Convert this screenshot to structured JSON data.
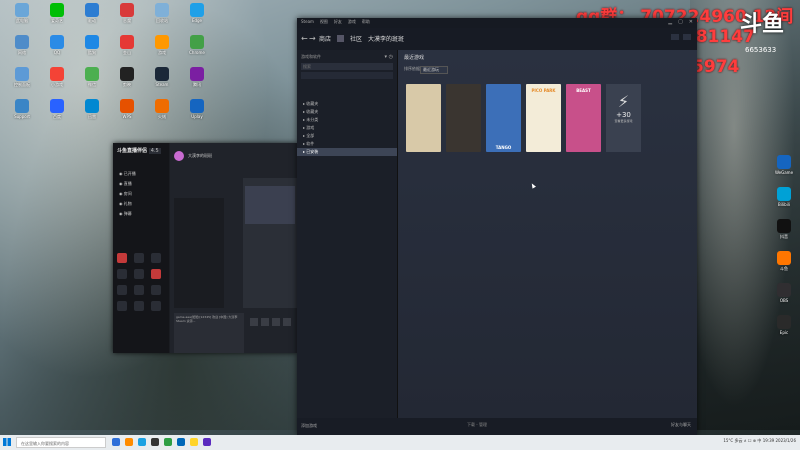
{
  "overlay": {
    "qq": "qq群：  707224960 12间",
    "uid": "UID99981147",
    "douyin": "抖音：  575995974",
    "logo": "斗鱼",
    "logo_sub": "6653633"
  },
  "steam": {
    "menu": [
      "Steam",
      "视图",
      "好友",
      "游戏",
      "帮助"
    ],
    "nav": {
      "store": "商店",
      "community": "社区",
      "profile": "大漠李的斑斑"
    },
    "sidebar": {
      "header": "游戏和软件",
      "search_placeholder": "搜索",
      "items": [
        "▸ 收藏夹",
        "▸ 收藏夹",
        "▸ 未分类",
        "▸ 游戏",
        "▸ 全部",
        "▸ 软件",
        "▸ 已安装"
      ],
      "selected_index": 6
    },
    "shelf": {
      "title": "最近游戏",
      "sort_label": "排序依据",
      "sort_value": "最近游玩"
    },
    "tiles": [
      {
        "name": "tile-game-1",
        "label": "",
        "color": "#d8c9a8"
      },
      {
        "name": "tile-game-2",
        "label": "",
        "color": "#3a3530"
      },
      {
        "name": "tile-game-3",
        "label": "TANGO",
        "color": "#3c6fb8"
      },
      {
        "name": "tile-game-4",
        "label": "PICO PARK",
        "color": "#f3ecd8"
      },
      {
        "name": "tile-game-5",
        "label": "BEAST",
        "color": "#c8508a"
      }
    ],
    "more_tile": {
      "count": "+30",
      "caption": "查看更多游戏"
    },
    "footer": {
      "add_game": "添加游戏",
      "downloads": "下载 - 管理",
      "friends": "好友与聊天"
    }
  },
  "app": {
    "brand": "斗鱼直播伴侣",
    "version": "4.5",
    "rows": [
      "◉ 已开播",
      "◉ 直播",
      "◉ 房间",
      "◉ 礼物",
      "◉ 弹幕"
    ],
    "chat_title": "大漠李的斑斑",
    "message": "game.aaa(斑斑)[12345]  欢迎 [中国] 大漠李 Steam 资源..."
  },
  "taskbar": {
    "search_placeholder": "在这里输入你要搜索的内容",
    "tray": "15°C 多云  ∧ ☐ ⊕ 中  19:39  2023/1/26",
    "app_colors": [
      "#2f6fd8",
      "#ff8c00",
      "#1ba1e2",
      "#333333",
      "#2f9e44",
      "#0067b8",
      "#ffd42a",
      "#5b2bbf"
    ]
  },
  "desktop_icons": [
    [
      "此电脑",
      "#6aa6d8"
    ],
    [
      "爱奇艺",
      "#00be06"
    ],
    [
      "驱动",
      "#2d7dd2"
    ],
    [
      "恶魔",
      "#d83a3a"
    ],
    [
      "回收站",
      "#7fb0d8"
    ],
    [
      "Edge",
      "#1fa0e8"
    ],
    [
      "网络",
      "#4f8cc9"
    ],
    [
      "QQ",
      "#2b8be6"
    ],
    [
      "酷狗",
      "#1e88e5"
    ],
    [
      "金山",
      "#e53935"
    ],
    [
      "游戏",
      "#ff9800"
    ],
    [
      "Chrome",
      "#43a047"
    ],
    [
      "控制面板",
      "#5d9ad6"
    ],
    [
      "小游戏",
      "#f44336"
    ],
    [
      "微信",
      "#4caf50"
    ],
    [
      "剪映",
      "#222222"
    ],
    [
      "Steam",
      "#1b2838"
    ],
    [
      "腾讯",
      "#7b1fa2"
    ],
    [
      "Support",
      "#3a85c6"
    ],
    [
      "百度",
      "#2962ff"
    ],
    [
      "迅雷",
      "#0288d1"
    ],
    [
      "WPS",
      "#e65100"
    ],
    [
      "火绒",
      "#ef6c00"
    ],
    [
      "Uplay",
      "#1565c0"
    ]
  ],
  "desktop_icons_right": [
    [
      "WeGame",
      "#1565c0"
    ],
    [
      "Bilibili",
      "#00a1d6"
    ],
    [
      "抖音",
      "#111111"
    ],
    [
      "斗鱼",
      "#ff7600"
    ],
    [
      "OBS",
      "#302e31"
    ],
    [
      "Epic",
      "#2a2a2a"
    ]
  ]
}
